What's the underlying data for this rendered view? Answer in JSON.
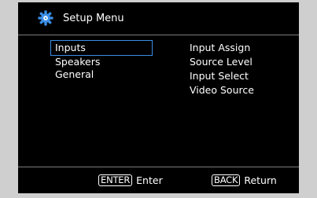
{
  "header": {
    "title": "Setup Menu",
    "icon": "gear-icon",
    "icon_color": "#3a8ee6"
  },
  "left_menu": {
    "items": [
      {
        "label": "Inputs",
        "selected": true
      },
      {
        "label": "Speakers",
        "selected": false
      },
      {
        "label": "General",
        "selected": false
      }
    ]
  },
  "right_list": {
    "items": [
      {
        "label": "Input Assign"
      },
      {
        "label": "Source Level"
      },
      {
        "label": "Input Select"
      },
      {
        "label": "Video Source"
      }
    ]
  },
  "footer": {
    "enter_key": "ENTER",
    "enter_label": "Enter",
    "back_key": "BACK",
    "back_label": "Return"
  },
  "colors": {
    "background": "#000000",
    "selection_border": "#3a8ee6",
    "divider": "#7d7d7d"
  }
}
